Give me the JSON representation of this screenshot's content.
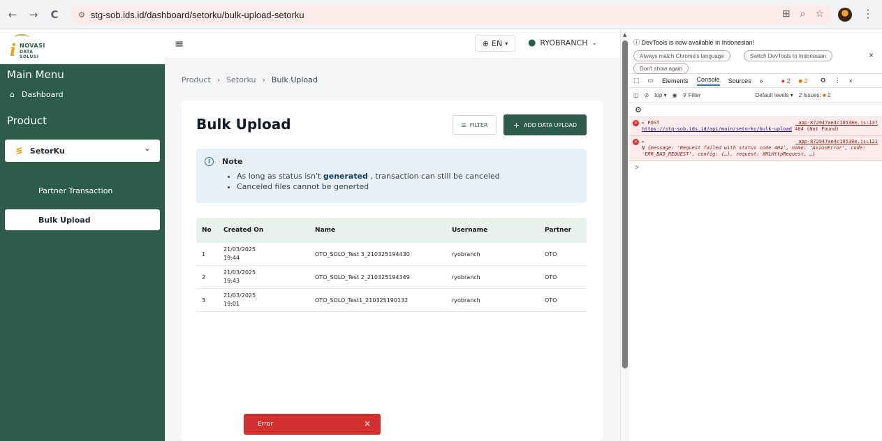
{
  "browser": {
    "url": "stg-sob.ids.id/dashboard/setorku/bulk-upload-setorku",
    "back": "←",
    "forward": "→",
    "reload": "C"
  },
  "sidebar": {
    "logo_main": "NOVASI",
    "logo_sub": "DATA SOLUSI",
    "main_menu": "Main Menu",
    "dashboard": "Dashboard",
    "product": "Product",
    "setorku": "SetorKu",
    "partner_transaction": "Partner Transaction",
    "bulk_upload": "Bulk Upload"
  },
  "topbar": {
    "lang": "EN",
    "user": "RYOBRANCH"
  },
  "breadcrumb": [
    "Product",
    "Setorku",
    "Bulk Upload"
  ],
  "card": {
    "title": "Bulk Upload",
    "filter_label": "FILTER",
    "add_label": "ADD DATA UPLOAD"
  },
  "note": {
    "title": "Note",
    "line1_pre": "As long as status isn't ",
    "line1_bold": "generated",
    "line1_post": " , transaction can still be canceled",
    "line2": "Canceled files cannot be generted"
  },
  "table": {
    "headers": [
      "No",
      "Created On",
      "Name",
      "Username",
      "Partner"
    ],
    "rows": [
      {
        "no": "1",
        "date": "21/03/2025",
        "time": "19:44",
        "name": "OTO_SOLO_Test 3_210325194430",
        "username": "ryobranch",
        "partner": "OTO"
      },
      {
        "no": "2",
        "date": "21/03/2025",
        "time": "19:43",
        "name": "OTO_SOLO_Test 2_210325194349",
        "username": "ryobranch",
        "partner": "OTO"
      },
      {
        "no": "3",
        "date": "21/03/2025",
        "time": "19:01",
        "name": "OTO_SOLO_Test1_210325190132",
        "username": "ryobranch",
        "partner": "OTO"
      }
    ]
  },
  "toast": {
    "message": "Error",
    "close": "×"
  },
  "devtools": {
    "banner": "DevTools is now available in Indonesian!",
    "btn_match": "Always match Chrome's language",
    "btn_switch": "Switch DevTools to Indonesian",
    "btn_dont": "Don't show again",
    "tab_elements": "Elements",
    "tab_console": "Console",
    "tab_sources": "Sources",
    "err_count": "2",
    "warn_count": "2",
    "context": "top ▾",
    "filter": "Filter",
    "levels": "Default levels ▾",
    "issues": "2 Issues: ",
    "issues_count": "2",
    "err1_method": "▸ POST",
    "err1_src": "_app-872947ae4c10538e.js:137",
    "err1_url": "https://stg-sob.ids.id/api/main/setorku/bulk-upload",
    "err1_status": " 404 (Not Found)",
    "err2_src": "_app-872947ae4c10538e.js:121",
    "err2_text": "N {message: 'Request failed with status code 404', name: 'AxiosError', code: 'ERR_BAD_REQUEST', config: {…}, request: XMLHttpRequest, …}",
    "prompt": ">"
  }
}
